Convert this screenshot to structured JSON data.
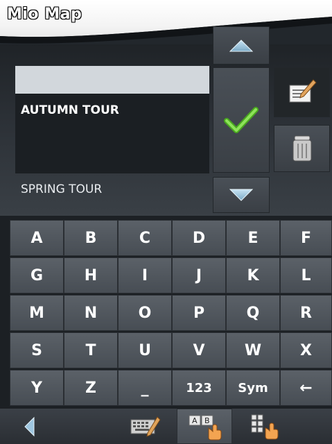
{
  "app": {
    "title": "Mio Map"
  },
  "tours": {
    "input_value": "",
    "items": [
      {
        "label": "AUTUMN TOUR",
        "state": "highlighted"
      },
      {
        "label": "SPRING TOUR",
        "state": "normal"
      }
    ]
  },
  "actions": {
    "up_icon": "triangle-up-icon",
    "confirm_icon": "checkmark-icon",
    "down_icon": "triangle-down-icon",
    "edit_icon": "edit-note-icon",
    "delete_icon": "trash-icon"
  },
  "keyboard": {
    "rows": [
      [
        "A",
        "B",
        "C",
        "D",
        "E",
        "F"
      ],
      [
        "G",
        "H",
        "I",
        "J",
        "K",
        "L"
      ],
      [
        "M",
        "N",
        "O",
        "P",
        "Q",
        "R"
      ],
      [
        "S",
        "T",
        "U",
        "V",
        "W",
        "X"
      ],
      [
        "Y",
        "Z",
        "_",
        "123",
        "Sym",
        "←"
      ]
    ]
  },
  "bottom_bar": {
    "back_icon": "back-arrow-icon",
    "kbd_icons": [
      "keyboard-pencil-icon",
      "abc-keyboard-icon",
      "grid-keyboard-icon"
    ]
  },
  "colors": {
    "check": "#6fd13a",
    "accent_red": "#c0392b"
  }
}
